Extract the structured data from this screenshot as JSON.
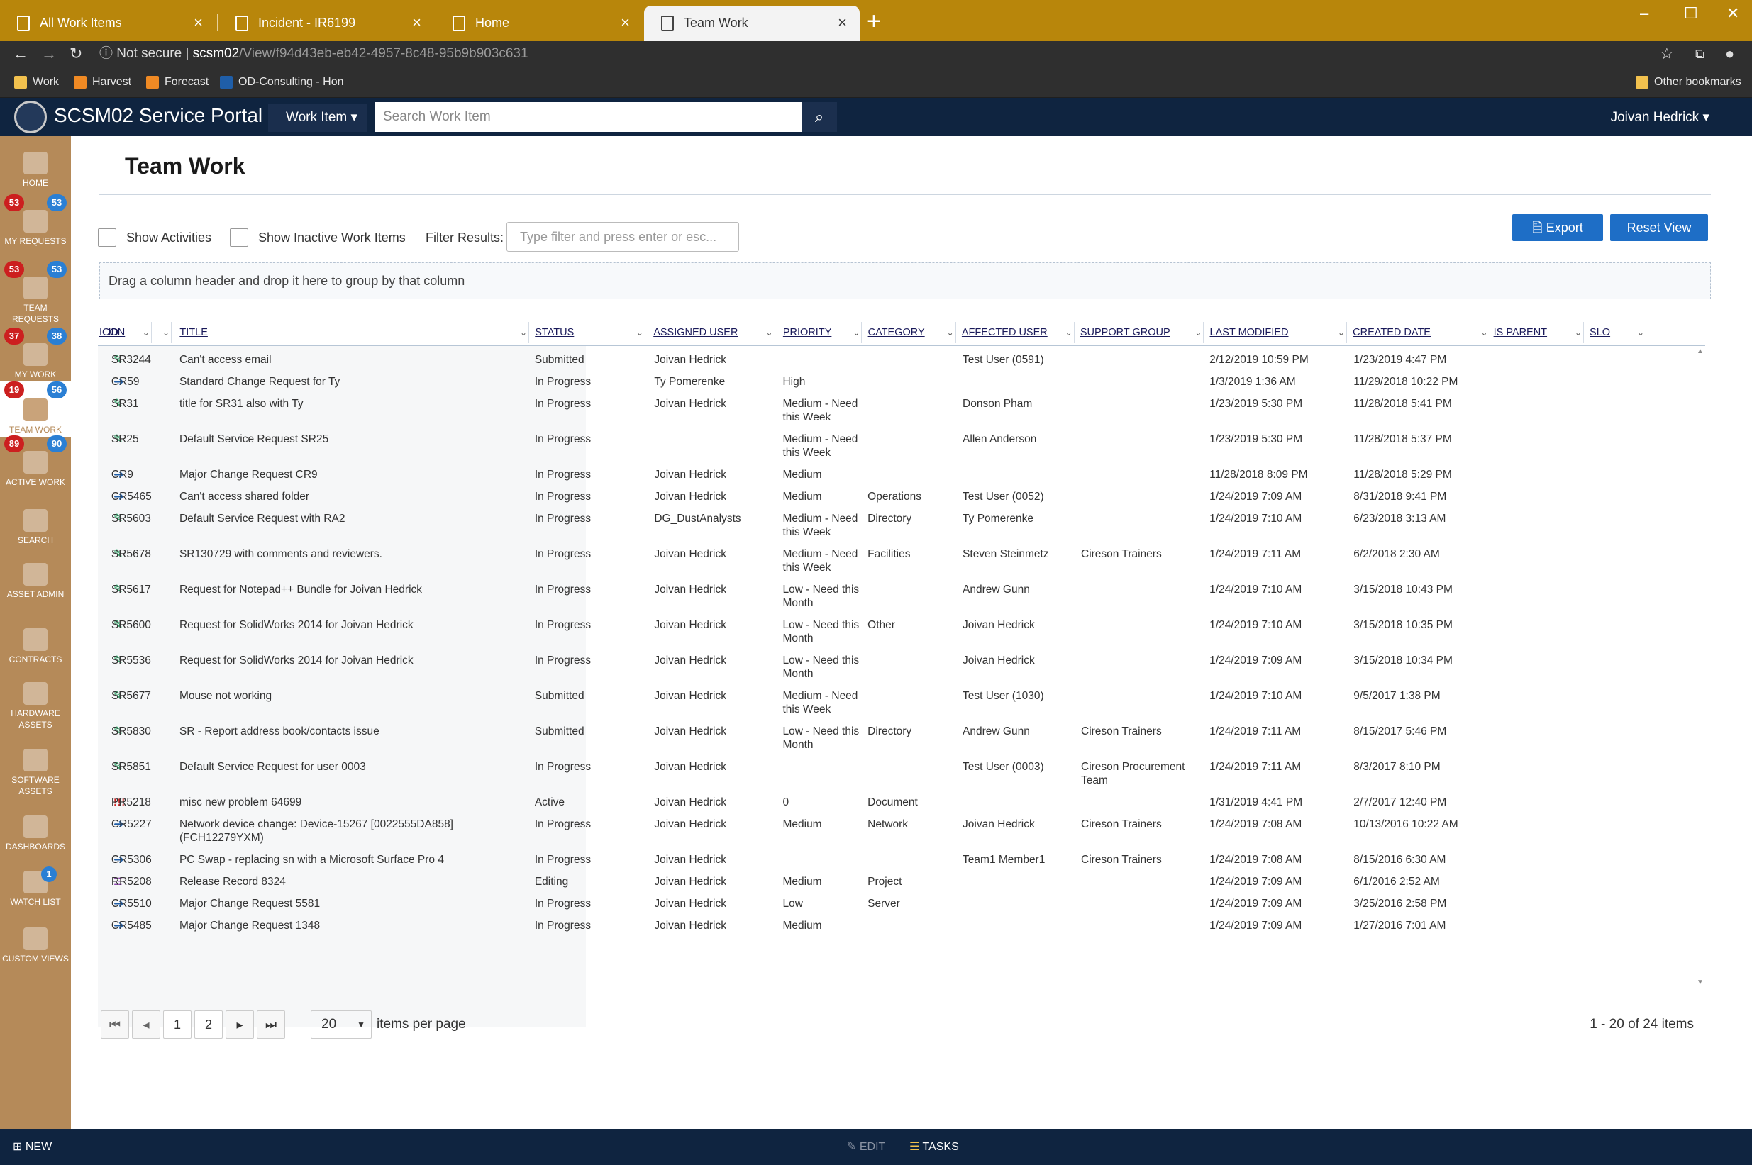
{
  "browser": {
    "tabs": [
      {
        "label": "All Work Items"
      },
      {
        "label": "Incident - IR6199"
      },
      {
        "label": "Home"
      },
      {
        "label": "Team Work"
      }
    ],
    "address": {
      "security": "Not secure",
      "host": "scsm02",
      "path": "/View/f94d43eb-eb42-4957-8c48-95b9b903c631"
    },
    "bookmarks": [
      {
        "label": "Work",
        "color": "#f2c14e"
      },
      {
        "label": "Harvest",
        "color": "#f08a24"
      },
      {
        "label": "Forecast",
        "color": "#f08a24"
      },
      {
        "label": "OD-Consulting - Hon",
        "color": "#1f5ea8"
      }
    ],
    "other_bookmarks": "Other bookmarks"
  },
  "header": {
    "app_title": "SCSM02 Service Portal",
    "workitem_dropdown": "Work Item",
    "search_placeholder": "Search Work Item",
    "user": "Joivan Hedrick"
  },
  "sidebar": {
    "items": [
      {
        "label": "HOME",
        "icon": "home-icon"
      },
      {
        "label": "MY REQUESTS",
        "icon": "chat-icon",
        "badge_red": "53",
        "badge_blue": "53"
      },
      {
        "label": "TEAM REQUESTS",
        "icon": "chat-icon",
        "badge_red": "53",
        "badge_blue": "53"
      },
      {
        "label": "MY WORK",
        "icon": "user-icon",
        "badge_red": "37",
        "badge_blue": "38"
      },
      {
        "label": "TEAM WORK",
        "icon": "team-icon",
        "badge_red": "19",
        "badge_blue": "56"
      },
      {
        "label": "ACTIVE WORK",
        "icon": "list-icon",
        "badge_red": "89",
        "badge_blue": "90"
      },
      {
        "label": "SEARCH",
        "icon": "search-icon"
      },
      {
        "label": "ASSET ADMIN",
        "icon": "wrench-icon"
      },
      {
        "label": "CONTRACTS",
        "icon": "document-icon"
      },
      {
        "label": "HARDWARE ASSETS",
        "icon": "laptop-icon"
      },
      {
        "label": "SOFTWARE ASSETS",
        "icon": "disk-icon"
      },
      {
        "label": "DASHBOARDS",
        "icon": "pie-icon"
      },
      {
        "label": "WATCH LIST",
        "icon": "binoculars-icon",
        "badge_blue": "1"
      },
      {
        "label": "CUSTOM VIEWS",
        "icon": "folder-icon"
      }
    ]
  },
  "main": {
    "title": "Team Work",
    "show_activities": "Show Activities",
    "show_inactive": "Show Inactive Work Items",
    "filter_label": "Filter Results:",
    "filter_placeholder": "Type filter and press enter or esc...",
    "export": "Export",
    "reset_view": "Reset View",
    "group_hint": "Drag a column header and drop it here to group by that column"
  },
  "grid": {
    "columns": [
      "ICON",
      "ID",
      "TITLE",
      "STATUS",
      "ASSIGNED USER",
      "PRIORITY",
      "CATEGORY",
      "AFFECTED USER",
      "SUPPORT GROUP",
      "LAST MODIFIED",
      "CREATED DATE",
      "IS PARENT",
      "SLO"
    ],
    "rows": [
      {
        "type": "sr",
        "id": "SR3244",
        "title": "Can't access email",
        "status": "Submitted",
        "assigned": "Joivan Hedrick",
        "priority": "",
        "category": "",
        "affected": "Test User (0591)",
        "support": "",
        "modified": "2/12/2019 10:59 PM",
        "created": "1/23/2019 4:47 PM"
      },
      {
        "type": "cr",
        "id": "CR59",
        "title": "Standard Change Request for Ty",
        "status": "In Progress",
        "assigned": "Ty Pomerenke",
        "priority": "High",
        "category": "",
        "affected": "",
        "support": "",
        "modified": "1/3/2019 1:36 AM",
        "created": "11/29/2018 10:22 PM"
      },
      {
        "type": "sr",
        "id": "SR31",
        "title": "title for SR31 also with Ty",
        "status": "In Progress",
        "assigned": "Joivan Hedrick",
        "priority": "Medium - Need this Week",
        "category": "",
        "affected": "Donson Pham",
        "support": "",
        "modified": "1/23/2019 5:30 PM",
        "created": "11/28/2018 5:41 PM"
      },
      {
        "type": "sr",
        "id": "SR25",
        "title": "Default Service Request SR25",
        "status": "In Progress",
        "assigned": "",
        "priority": "Medium - Need this Week",
        "category": "",
        "affected": "Allen Anderson",
        "support": "",
        "modified": "1/23/2019 5:30 PM",
        "created": "11/28/2018 5:37 PM"
      },
      {
        "type": "cr",
        "id": "CR9",
        "title": "Major Change Request CR9",
        "status": "In Progress",
        "assigned": "Joivan Hedrick",
        "priority": "Medium",
        "category": "",
        "affected": "",
        "support": "",
        "modified": "11/28/2018 8:09 PM",
        "created": "11/28/2018 5:29 PM"
      },
      {
        "type": "cr",
        "id": "CR5465",
        "title": "Can't access shared folder",
        "status": "In Progress",
        "assigned": "Joivan Hedrick",
        "priority": "Medium",
        "category": "Operations",
        "affected": "Test User (0052)",
        "support": "",
        "modified": "1/24/2019 7:09 AM",
        "created": "8/31/2018 9:41 PM"
      },
      {
        "type": "sr",
        "id": "SR5603",
        "title": "Default Service Request with RA2",
        "status": "In Progress",
        "assigned": "DG_DustAnalysts",
        "priority": "Medium - Need this Week",
        "category": "Directory",
        "affected": "Ty Pomerenke",
        "support": "",
        "modified": "1/24/2019 7:10 AM",
        "created": "6/23/2018 3:13 AM"
      },
      {
        "type": "sr",
        "id": "SR5678",
        "title": "SR130729 with comments and reviewers.",
        "status": "In Progress",
        "assigned": "Joivan Hedrick",
        "priority": "Medium - Need this Week",
        "category": "Facilities",
        "affected": "Steven Steinmetz",
        "support": "Cireson Trainers",
        "modified": "1/24/2019 7:11 AM",
        "created": "6/2/2018 2:30 AM"
      },
      {
        "type": "sr",
        "id": "SR5617",
        "title": "Request for Notepad++ Bundle for Joivan Hedrick",
        "status": "In Progress",
        "assigned": "Joivan Hedrick",
        "priority": "Low - Need this Month",
        "category": "",
        "affected": "Andrew Gunn",
        "support": "",
        "modified": "1/24/2019 7:10 AM",
        "created": "3/15/2018 10:43 PM"
      },
      {
        "type": "sr",
        "id": "SR5600",
        "title": "Request for SolidWorks 2014 for Joivan Hedrick",
        "status": "In Progress",
        "assigned": "Joivan Hedrick",
        "priority": "Low - Need this Month",
        "category": "Other",
        "affected": "Joivan Hedrick",
        "support": "",
        "modified": "1/24/2019 7:10 AM",
        "created": "3/15/2018 10:35 PM"
      },
      {
        "type": "sr",
        "id": "SR5536",
        "title": "Request for SolidWorks 2014 for Joivan Hedrick",
        "status": "In Progress",
        "assigned": "Joivan Hedrick",
        "priority": "Low - Need this Month",
        "category": "",
        "affected": "Joivan Hedrick",
        "support": "",
        "modified": "1/24/2019 7:09 AM",
        "created": "3/15/2018 10:34 PM"
      },
      {
        "type": "sr",
        "id": "SR5677",
        "title": "Mouse not working",
        "status": "Submitted",
        "assigned": "Joivan Hedrick",
        "priority": "Medium - Need this Week",
        "category": "",
        "affected": "Test User (1030)",
        "support": "",
        "modified": "1/24/2019 7:10 AM",
        "created": "9/5/2017 1:38 PM"
      },
      {
        "type": "sr",
        "id": "SR5830",
        "title": "SR - Report address book/contacts issue",
        "status": "Submitted",
        "assigned": "Joivan Hedrick",
        "priority": "Low - Need this Month",
        "category": "Directory",
        "affected": "Andrew Gunn",
        "support": "Cireson Trainers",
        "modified": "1/24/2019 7:11 AM",
        "created": "8/15/2017 5:46 PM"
      },
      {
        "type": "sr",
        "id": "SR5851",
        "title": "Default Service Request for user 0003",
        "status": "In Progress",
        "assigned": "Joivan Hedrick",
        "priority": "",
        "category": "",
        "affected": "Test User (0003)",
        "support": "Cireson Procurement Team",
        "modified": "1/24/2019 7:11 AM",
        "created": "8/3/2017 8:10 PM"
      },
      {
        "type": "pr",
        "id": "PR5218",
        "title": "misc new problem 64699",
        "status": "Active",
        "assigned": "Joivan Hedrick",
        "priority": "0",
        "category": "Document",
        "affected": "",
        "support": "",
        "modified": "1/31/2019 4:41 PM",
        "created": "2/7/2017 12:40 PM"
      },
      {
        "type": "cr",
        "id": "CR5227",
        "title": "Network device change: Device-15267 [0022555DA858] (FCH12279YXM)",
        "status": "In Progress",
        "assigned": "Joivan Hedrick",
        "priority": "Medium",
        "category": "Network",
        "affected": "Joivan Hedrick",
        "support": "Cireson Trainers",
        "modified": "1/24/2019 7:08 AM",
        "created": "10/13/2016 10:22 AM"
      },
      {
        "type": "cr",
        "id": "CR5306",
        "title": "PC Swap - replacing sn with a Microsoft Surface Pro 4",
        "status": "In Progress",
        "assigned": "Joivan Hedrick",
        "priority": "",
        "category": "",
        "affected": "Team1 Member1",
        "support": "Cireson Trainers",
        "modified": "1/24/2019 7:08 AM",
        "created": "8/15/2016 6:30 AM"
      },
      {
        "type": "rr",
        "id": "RR5208",
        "title": "Release Record 8324",
        "status": "Editing",
        "assigned": "Joivan Hedrick",
        "priority": "Medium",
        "category": "Project",
        "affected": "",
        "support": "",
        "modified": "1/24/2019 7:09 AM",
        "created": "6/1/2016 2:52 AM"
      },
      {
        "type": "cr",
        "id": "CR5510",
        "title": "Major Change Request 5581",
        "status": "In Progress",
        "assigned": "Joivan Hedrick",
        "priority": "Low",
        "category": "Server",
        "affected": "",
        "support": "",
        "modified": "1/24/2019 7:09 AM",
        "created": "3/25/2016 2:58 PM"
      },
      {
        "type": "cr",
        "id": "CR5485",
        "title": "Major Change Request 1348",
        "status": "In Progress",
        "assigned": "Joivan Hedrick",
        "priority": "Medium",
        "category": "",
        "affected": "",
        "support": "",
        "modified": "1/24/2019 7:09 AM",
        "created": "1/27/2016 7:01 AM"
      }
    ]
  },
  "pager": {
    "pages": [
      "1",
      "2"
    ],
    "per_page": "20",
    "per_page_label": "items per page",
    "info": "1 - 20 of 24 items"
  },
  "footer": {
    "new": "NEW",
    "edit": "EDIT",
    "tasks": "TASKS"
  },
  "colors": {
    "accent": "#1e6ec6",
    "chrome": "#b8860b",
    "header": "#0f2440",
    "sidebar": "#b58a59"
  }
}
